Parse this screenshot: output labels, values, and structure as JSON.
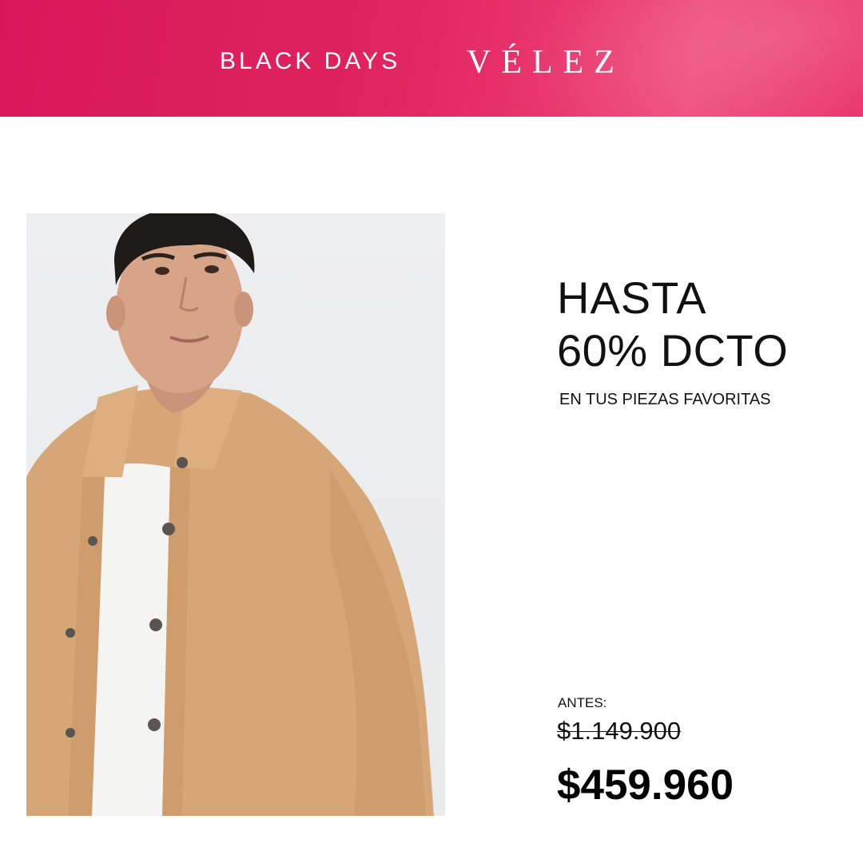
{
  "banner": {
    "campaign_label": "BLACK DAYS",
    "brand": "VÉLEZ",
    "color": "#e0245f"
  },
  "promo": {
    "line1": "HASTA",
    "line2": "60% DCTO",
    "subline": "EN TUS PIEZAS FAVORITAS"
  },
  "pricing": {
    "before_label": "ANTES:",
    "old_price": "$1.149.900",
    "new_price": "$459.960"
  },
  "product_image": {
    "shirt_color": "#d7a877",
    "background": "#eceded"
  }
}
